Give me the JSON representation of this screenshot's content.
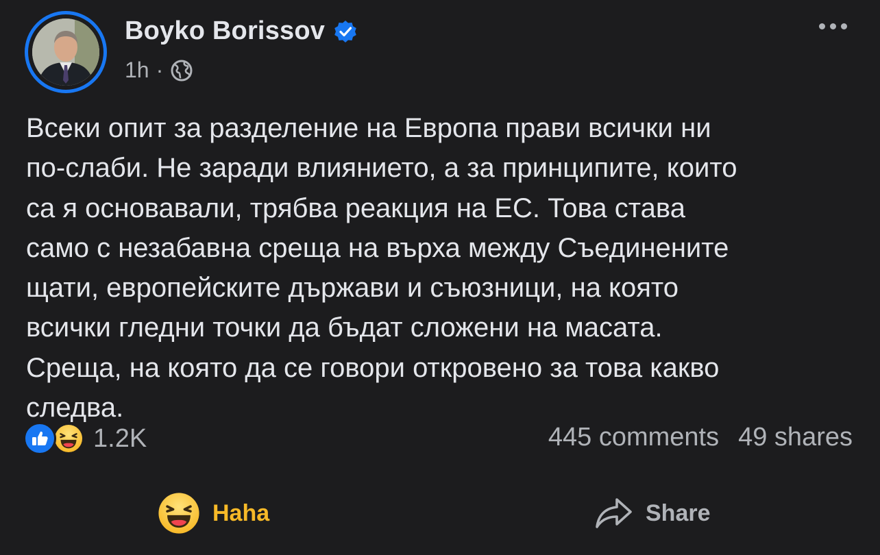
{
  "header": {
    "author_name": "Boyko Borissov",
    "time": "1h",
    "separator": "·",
    "audience_icon": "globe-icon",
    "verified_icon": "verified-badge-icon",
    "more_icon": "more-options-icon"
  },
  "post": {
    "text": "Всеки опит за разделение на Европа прави всички ни\nпо-слаби. Не заради влиянието, а за принципите, които\nса я основавали, трябва реакция на ЕС. Това става\nсамо с незабавна среща на върха между Съединените\nщати, европейските държави и съюзници, на която\nвсички гледни точки да бъдат сложени на масата.\nСреща, на която да се говори откровено за това какво\nследва."
  },
  "stats": {
    "reaction_icons": [
      "like-icon",
      "haha-icon"
    ],
    "reaction_count": "1.2K",
    "comments": "445 comments",
    "shares": "49 shares"
  },
  "actions": {
    "reaction_label": "Haha",
    "share_label": "Share"
  },
  "colors": {
    "background": "#1c1c1e",
    "primary_text": "#e4e6eb",
    "secondary_text": "#b0b3b8",
    "accent_blue": "#1877f2",
    "haha_yellow": "#f7b928"
  }
}
